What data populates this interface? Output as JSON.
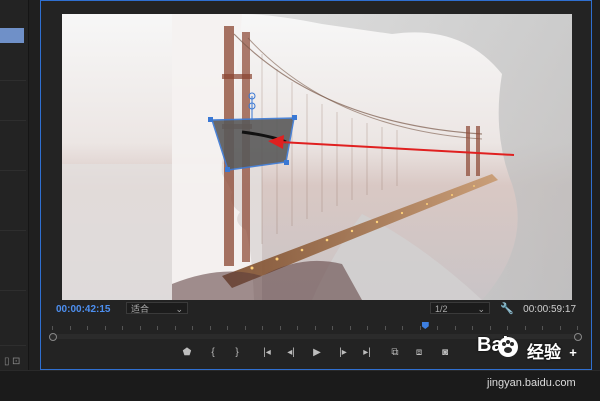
{
  "monitor": {
    "current_timecode": "00:00:42:15",
    "fit_label": "适合",
    "resolution": "1/2",
    "duration_timecode": "00:00:59:17",
    "playhead_fraction": 0.71
  },
  "transport": {
    "marker": "marker-icon",
    "in_point": "{",
    "out_point": "}",
    "go_to_in": "go-to-in-icon",
    "step_back": "step-back-icon",
    "play": "play-icon",
    "step_forward": "step-forward-icon",
    "go_to_out": "go-to-out-icon",
    "insert": "insert-icon",
    "overwrite": "overwrite-icon",
    "export_frame": "camera-icon",
    "add": "+"
  },
  "watermark": {
    "logo_text": "Bai",
    "brand_cn": "经验",
    "url": "jingyan.baidu.com"
  },
  "colors": {
    "accent": "#2f6fd0",
    "timecode": "#4d8ff0",
    "arrow": "#e02020",
    "selection": "#3a78d4"
  }
}
